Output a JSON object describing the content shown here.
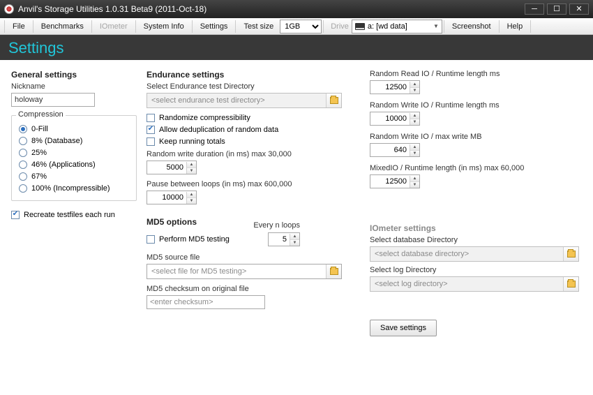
{
  "titlebar": {
    "title": "Anvil's Storage Utilities 1.0.31 Beta9 (2011-Oct-18)"
  },
  "menu": {
    "file": "File",
    "benchmarks": "Benchmarks",
    "iometer": "IOmeter",
    "system_info": "System Info",
    "settings": "Settings",
    "test_size_lbl": "Test size",
    "test_size_val": "1GB",
    "drive_lbl": "Drive",
    "drive_val": "a: [wd data]",
    "screenshot": "Screenshot",
    "help": "Help"
  },
  "page_header": "Settings",
  "general": {
    "heading": "General settings",
    "nickname_lbl": "Nickname",
    "nickname_val": "holoway",
    "compression_legend": "Compression",
    "compression_options": [
      "0-Fill",
      "8% (Database)",
      "25%",
      "46% (Applications)",
      "67%",
      "100% (Incompressible)"
    ],
    "recreate_lbl": "Recreate testfiles each run"
  },
  "endurance": {
    "heading": "Endurance settings",
    "select_dir_lbl": "Select Endurance test Directory",
    "select_dir_ph": "<select endurance test directory>",
    "randomize_lbl": "Randomize compressibility",
    "allow_dedup_lbl": "Allow deduplication of random data",
    "keep_totals_lbl": "Keep running totals",
    "rand_write_dur_lbl": "Random write duration (in ms) max 30,000",
    "rand_write_dur_val": "5000",
    "pause_lbl": "Pause between loops (in ms) max 600,000",
    "pause_val": "10000"
  },
  "md5": {
    "heading": "MD5 options",
    "every_lbl": "Every n loops",
    "every_val": "5",
    "perform_lbl": "Perform MD5 testing",
    "source_lbl": "MD5 source file",
    "source_ph": "<select file for MD5 testing>",
    "checksum_lbl": "MD5 checksum on original file",
    "checksum_ph": "<enter checksum>"
  },
  "runtime": {
    "rand_read_lbl": "Random Read IO / Runtime length ms",
    "rand_read_val": "12500",
    "rand_write_io_lbl": "Random Write IO / Runtime length ms",
    "rand_write_io_val": "10000",
    "rand_write_max_lbl": "Random Write IO / max write MB",
    "rand_write_max_val": "640",
    "mixed_lbl": "MixedIO / Runtime length (in ms) max 60,000",
    "mixed_val": "12500"
  },
  "iometer": {
    "heading": "IOmeter settings",
    "db_lbl": "Select database Directory",
    "db_ph": "<select database directory>",
    "log_lbl": "Select log Directory",
    "log_ph": "<select log directory>"
  },
  "save_btn": "Save settings"
}
